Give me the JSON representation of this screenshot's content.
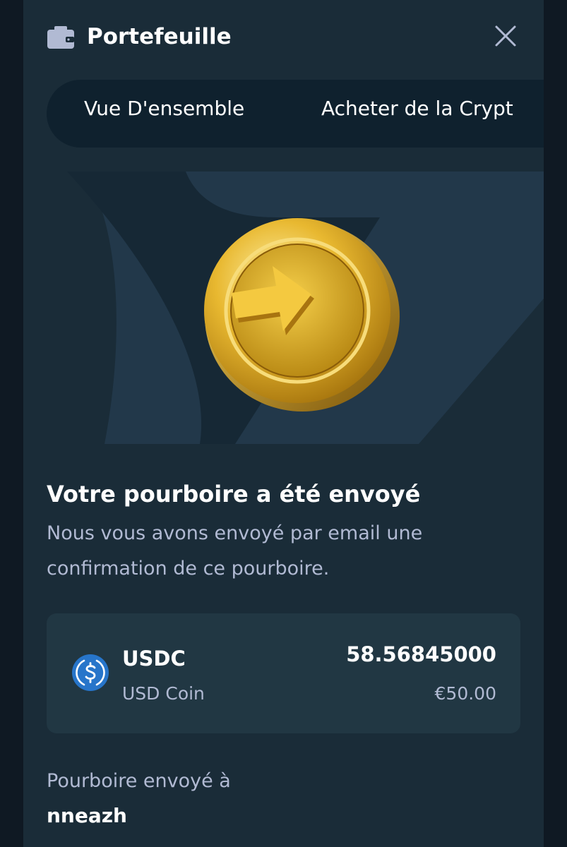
{
  "header": {
    "title": "Portefeuille",
    "icons": {
      "wallet": "wallet-icon",
      "close": "close-icon"
    }
  },
  "tabs": [
    {
      "label": "Vue D'ensemble"
    },
    {
      "label": "Acheter de la Crypt"
    }
  ],
  "hero": {
    "illustration": "gold-coin-arrow-icon"
  },
  "confirmation": {
    "heading": "Votre pourboire a été envoyé",
    "description": "Nous vous avons envoyé par email une confirmation de ce pourboire."
  },
  "transaction": {
    "coin_icon": "usdc-icon",
    "symbol": "USDC",
    "name": "USD Coin",
    "amount": "58.56845000",
    "fiat_value": "€50.00"
  },
  "recipient": {
    "label": "Pourboire envoyé à",
    "username": "nneazh"
  },
  "colors": {
    "background": "#0f1923",
    "panel": "#1a2c38",
    "card": "#213743",
    "muted_text": "#b1bad3",
    "usdc_blue": "#2775ca",
    "coin_gold": "#d4a017"
  }
}
